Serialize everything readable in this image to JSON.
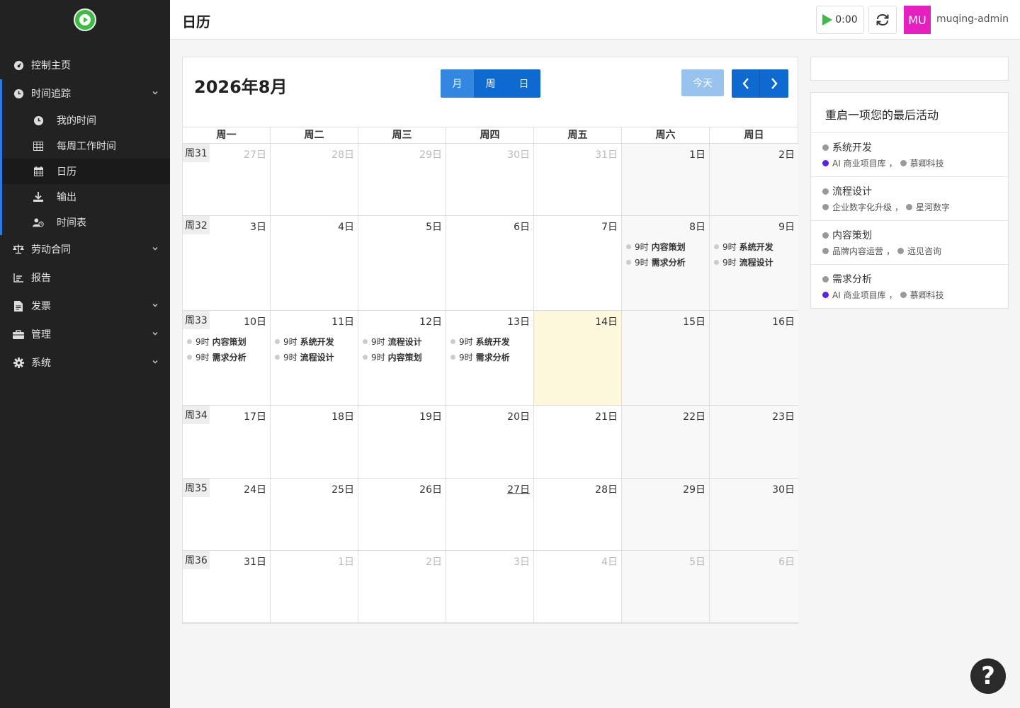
{
  "sidebar": {
    "items": [
      {
        "label": "控制主页",
        "icon": "dashboard-icon"
      },
      {
        "label": "时间追踪",
        "icon": "clock-icon"
      },
      {
        "label": "劳动合同",
        "icon": "balance-scale-icon"
      },
      {
        "label": "报告",
        "icon": "chart-icon"
      },
      {
        "label": "发票",
        "icon": "invoice-icon"
      },
      {
        "label": "管理",
        "icon": "toolbox-icon"
      },
      {
        "label": "系统",
        "icon": "gear-icon"
      }
    ],
    "sub_items": [
      {
        "label": "我的时间",
        "icon": "clock-icon"
      },
      {
        "label": "每周工作时间",
        "icon": "table-icon"
      },
      {
        "label": "日历",
        "icon": "calendar-icon"
      },
      {
        "label": "输出",
        "icon": "download-icon"
      },
      {
        "label": "时间表",
        "icon": "user-clock-icon"
      }
    ]
  },
  "header": {
    "title": "日历",
    "timer": "0:00",
    "avatar_initials": "MU",
    "username": "muqing-admin"
  },
  "calendar": {
    "title": "2026年8月",
    "views": [
      "月",
      "周",
      "日"
    ],
    "active_view": "月",
    "today_label": "今天",
    "weekdays": [
      "周一",
      "周二",
      "周三",
      "周四",
      "周五",
      "周六",
      "周日"
    ],
    "weeks": [
      {
        "label": "周31",
        "days": [
          {
            "n": "27日",
            "other": true
          },
          {
            "n": "28日",
            "other": true
          },
          {
            "n": "29日",
            "other": true
          },
          {
            "n": "30日",
            "other": true
          },
          {
            "n": "31日",
            "other": true
          },
          {
            "n": "1日"
          },
          {
            "n": "2日"
          }
        ]
      },
      {
        "label": "周32",
        "days": [
          {
            "n": "3日"
          },
          {
            "n": "4日"
          },
          {
            "n": "5日"
          },
          {
            "n": "6日"
          },
          {
            "n": "7日"
          },
          {
            "n": "8日",
            "events": [
              {
                "time": "9时",
                "name": "内容策划"
              },
              {
                "time": "9时",
                "name": "需求分析"
              }
            ]
          },
          {
            "n": "9日",
            "events": [
              {
                "time": "9时",
                "name": "系统开发"
              },
              {
                "time": "9时",
                "name": "流程设计"
              }
            ]
          }
        ]
      },
      {
        "label": "周33",
        "days": [
          {
            "n": "10日",
            "events": [
              {
                "time": "9时",
                "name": "内容策划"
              },
              {
                "time": "9时",
                "name": "需求分析"
              }
            ]
          },
          {
            "n": "11日",
            "events": [
              {
                "time": "9时",
                "name": "系统开发"
              },
              {
                "time": "9时",
                "name": "流程设计"
              }
            ]
          },
          {
            "n": "12日",
            "events": [
              {
                "time": "9时",
                "name": "流程设计"
              },
              {
                "time": "9时",
                "name": "内容策划"
              }
            ]
          },
          {
            "n": "13日",
            "events": [
              {
                "time": "9时",
                "name": "系统开发"
              },
              {
                "time": "9时",
                "name": "需求分析"
              }
            ]
          },
          {
            "n": "14日",
            "today": true
          },
          {
            "n": "15日"
          },
          {
            "n": "16日"
          }
        ]
      },
      {
        "label": "周34",
        "days": [
          {
            "n": "17日"
          },
          {
            "n": "18日"
          },
          {
            "n": "19日"
          },
          {
            "n": "20日"
          },
          {
            "n": "21日"
          },
          {
            "n": "22日"
          },
          {
            "n": "23日"
          }
        ]
      },
      {
        "label": "周35",
        "days": [
          {
            "n": "24日"
          },
          {
            "n": "25日"
          },
          {
            "n": "26日"
          },
          {
            "n": "27日",
            "underline": true
          },
          {
            "n": "28日"
          },
          {
            "n": "29日"
          },
          {
            "n": "30日"
          }
        ]
      },
      {
        "label": "周36",
        "days": [
          {
            "n": "31日"
          },
          {
            "n": "1日",
            "other": true
          },
          {
            "n": "2日",
            "other": true
          },
          {
            "n": "3日",
            "other": true
          },
          {
            "n": "4日",
            "other": true
          },
          {
            "n": "5日",
            "other": true
          },
          {
            "n": "6日",
            "other": true
          }
        ]
      }
    ]
  },
  "recent": {
    "title": "重启一项您的最后活动",
    "activities": [
      {
        "name": "系统开发",
        "project": "AI 商业项目库",
        "project_color": "#5b21e6",
        "customer": "慕卿科技"
      },
      {
        "name": "流程设计",
        "project": "企业数字化升级",
        "project_color": "#999999",
        "customer": "星河数字"
      },
      {
        "name": "内容策划",
        "project": "品牌内容运营",
        "project_color": "#999999",
        "customer": "远见咨询"
      },
      {
        "name": "需求分析",
        "project": "AI 商业项目库",
        "project_color": "#5b21e6",
        "customer": "慕卿科技"
      }
    ],
    "separator": "，"
  },
  "help": {
    "label": "?"
  },
  "colors": {
    "primary": "#0e6ad1",
    "sidebar_bg": "#222222",
    "today_bg": "#fdf7dc",
    "avatar_bg": "#e620c0",
    "accent_bar": "#2c7be5"
  }
}
